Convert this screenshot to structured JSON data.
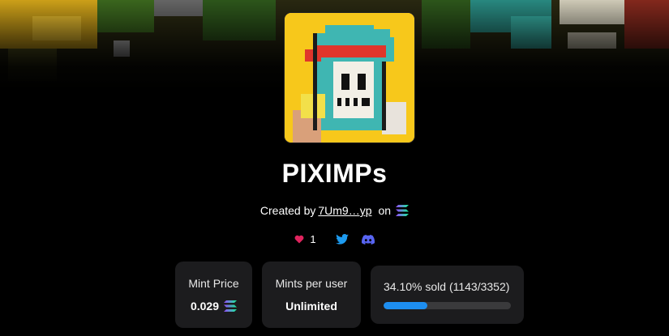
{
  "collection": {
    "name": "PIXIMPs",
    "created_by_label": "Created by",
    "creator_address": "7Um9…yp",
    "on_label": "on",
    "chain_icon": "solana-icon"
  },
  "social": {
    "likes_count": "1",
    "heart_icon": "heart-icon",
    "twitter_icon": "twitter-icon",
    "discord_icon": "discord-icon"
  },
  "stats": {
    "mint_price_label": "Mint Price",
    "mint_price_value": "0.029",
    "mints_per_user_label": "Mints per user",
    "mints_per_user_value": "Unlimited",
    "sold_text": "34.10% sold (1143/3352)",
    "sold_fraction": 0.341
  },
  "colors": {
    "background": "#000000",
    "card": "#1c1c1e",
    "progress_fill": "#1d8ef0",
    "progress_track": "#3a3a3c",
    "heart": "#e0245e",
    "twitter": "#1d9bf0",
    "discord": "#5865f2"
  }
}
